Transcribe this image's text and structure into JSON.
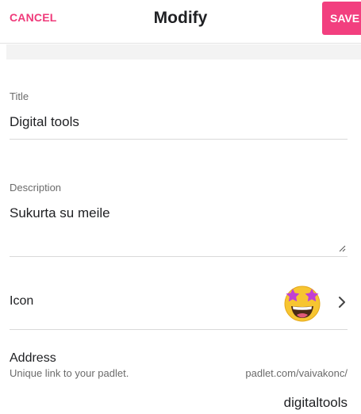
{
  "header": {
    "cancel_label": "CANCEL",
    "title": "Modify",
    "save_label": "SAVE"
  },
  "form": {
    "title": {
      "label": "Title",
      "value": "Digital tools"
    },
    "description": {
      "label": "Description",
      "value": "Sukurta su meile"
    },
    "icon": {
      "label": "Icon",
      "emoji": "star-struck-emoji",
      "chevron": "chevron-right-icon"
    },
    "address": {
      "label": "Address",
      "help": "Unique link to your padlet.",
      "base": "padlet.com/vaivakonc/",
      "slug": "digitaltools"
    }
  },
  "colors": {
    "accent": "#f23f7f",
    "text": "#202124",
    "muted": "#6b6b6b",
    "divider": "#d9d9d9"
  }
}
